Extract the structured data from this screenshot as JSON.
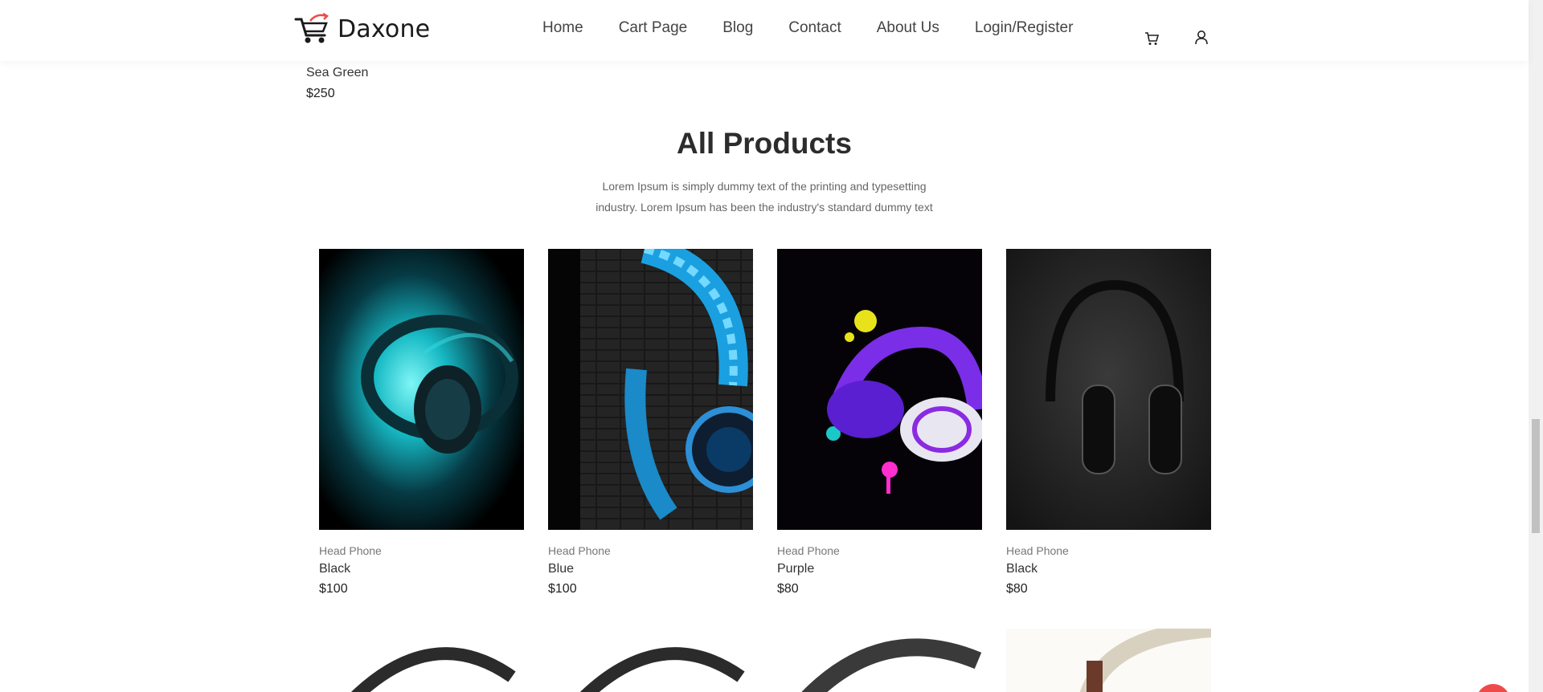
{
  "header": {
    "logo_text": "Daxone",
    "nav": [
      "Home",
      "Cart Page",
      "Blog",
      "Contact",
      "About Us",
      "Login/Register"
    ],
    "icons": [
      "cart-icon",
      "user-icon"
    ]
  },
  "previous_product": {
    "name": "Sea Green",
    "price": "$250"
  },
  "section": {
    "title": "All Products",
    "description": "Lorem Ipsum is simply dummy text of the printing and typesetting industry. Lorem Ipsum has been the industry's standard dummy text"
  },
  "products": [
    {
      "category": "Head Phone",
      "name": "Black",
      "price": "$100"
    },
    {
      "category": "Head Phone",
      "name": "Blue",
      "price": "$100"
    },
    {
      "category": "Head Phone",
      "name": "Purple",
      "price": "$80"
    },
    {
      "category": "Head Phone",
      "name": "Black",
      "price": "$80"
    }
  ],
  "colors": {
    "accent": "#ef4a4a",
    "text": "#333333",
    "muted": "#777777"
  }
}
